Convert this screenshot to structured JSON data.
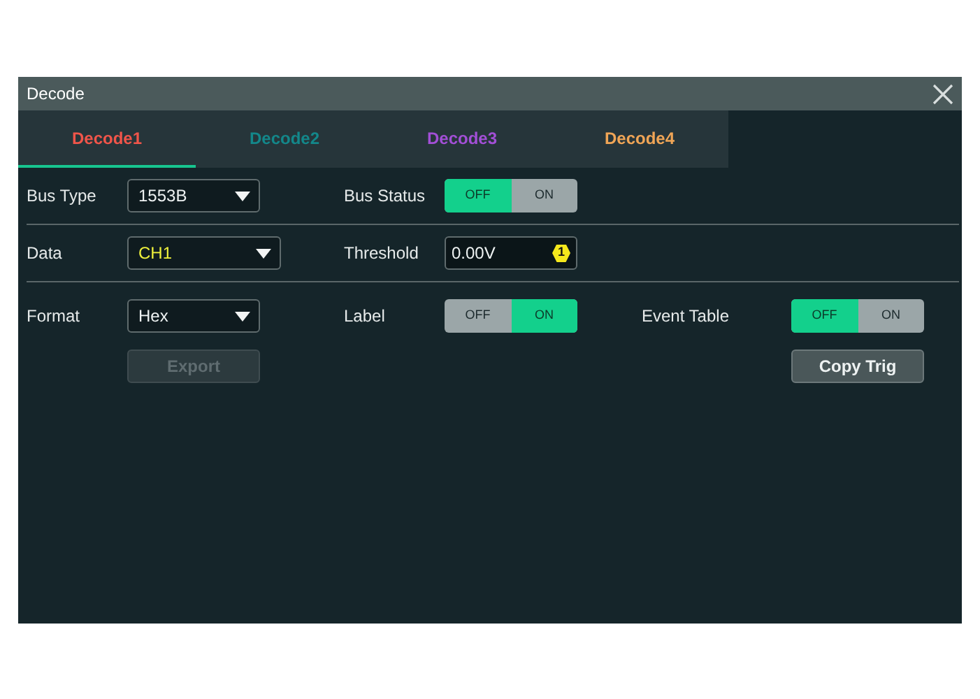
{
  "window": {
    "title": "Decode"
  },
  "tabs": [
    {
      "label": "Decode1",
      "color": "#f0554a",
      "selected": true
    },
    {
      "label": "Decode2",
      "color": "#13878a",
      "selected": false
    },
    {
      "label": "Decode3",
      "color": "#a24fd6",
      "selected": false
    },
    {
      "label": "Decode4",
      "color": "#f0a556",
      "selected": false
    }
  ],
  "rows": [
    {
      "items": [
        {
          "kind": "label",
          "text": "Bus Type"
        },
        {
          "kind": "dropdown",
          "value": "1553B"
        },
        {
          "kind": "label",
          "text": "Bus Status"
        },
        {
          "kind": "toggle",
          "off_label": "OFF",
          "on_label": "ON",
          "on": false
        }
      ]
    },
    {
      "items": [
        {
          "kind": "label",
          "text": "Data"
        },
        {
          "kind": "dropdown",
          "value": "CH1",
          "color": "#eef03c"
        },
        {
          "kind": "label",
          "text": "Threshold"
        },
        {
          "kind": "input",
          "value": "0.00V",
          "badge": "1"
        }
      ]
    },
    {
      "items": [
        {
          "kind": "label",
          "text": "Format"
        },
        {
          "kind": "dropdown",
          "value": "Hex"
        },
        {
          "kind": "label",
          "text": "Label"
        },
        {
          "kind": "toggle",
          "off_label": "OFF",
          "on_label": "ON",
          "on": true
        },
        {
          "kind": "label",
          "text": "Event Table"
        },
        {
          "kind": "toggle",
          "off_label": "OFF",
          "on_label": "ON",
          "on": false
        }
      ]
    }
  ],
  "actions": {
    "left": {
      "label": "Export",
      "disabled": true
    },
    "right": {
      "label": "Copy Trig",
      "disabled": false
    }
  }
}
